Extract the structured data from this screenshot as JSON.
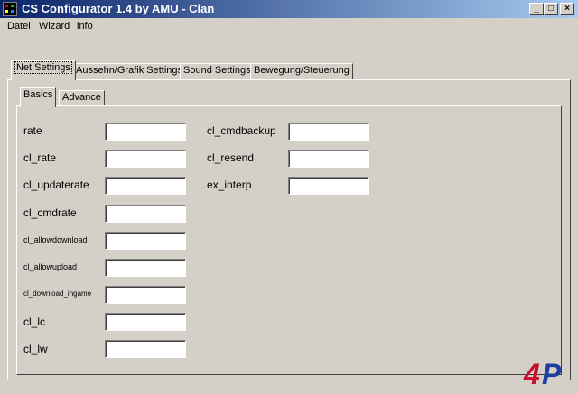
{
  "window": {
    "title": "CS Configurator 1.4 by AMU - Clan",
    "controls": {
      "minimize": "_",
      "maximize": "□",
      "close": "×"
    }
  },
  "menu": [
    "Datei",
    "Wizard",
    "info"
  ],
  "outer_tabs": [
    "Net Settings",
    "Aussehn/Grafik Settings",
    "Sound Settings",
    "Bewegung/Steuerung"
  ],
  "inner_tabs": [
    "Basics",
    "Advance"
  ],
  "left_fields": [
    {
      "label": "rate",
      "value": ""
    },
    {
      "label": "cl_rate",
      "value": ""
    },
    {
      "label": "cl_updaterate",
      "value": ""
    },
    {
      "label": "cl_cmdrate",
      "value": ""
    },
    {
      "label": "cl_allowdownload",
      "value": ""
    },
    {
      "label": "cl_allowupload",
      "value": ""
    },
    {
      "label": "cl_download_ingame",
      "value": ""
    },
    {
      "label": "cl_lc",
      "value": ""
    },
    {
      "label": "cl_lw",
      "value": ""
    }
  ],
  "right_fields": [
    {
      "label": "cl_cmdbackup",
      "value": ""
    },
    {
      "label": "cl_resend",
      "value": ""
    },
    {
      "label": "ex_interp",
      "value": ""
    }
  ],
  "watermark": "4P",
  "colors": {
    "titlebar_start": "#0a246a",
    "titlebar_end": "#a6caf0",
    "face": "#d4d0c8",
    "logo_blue": "#1d3f9e",
    "logo_red": "#c8102e"
  }
}
